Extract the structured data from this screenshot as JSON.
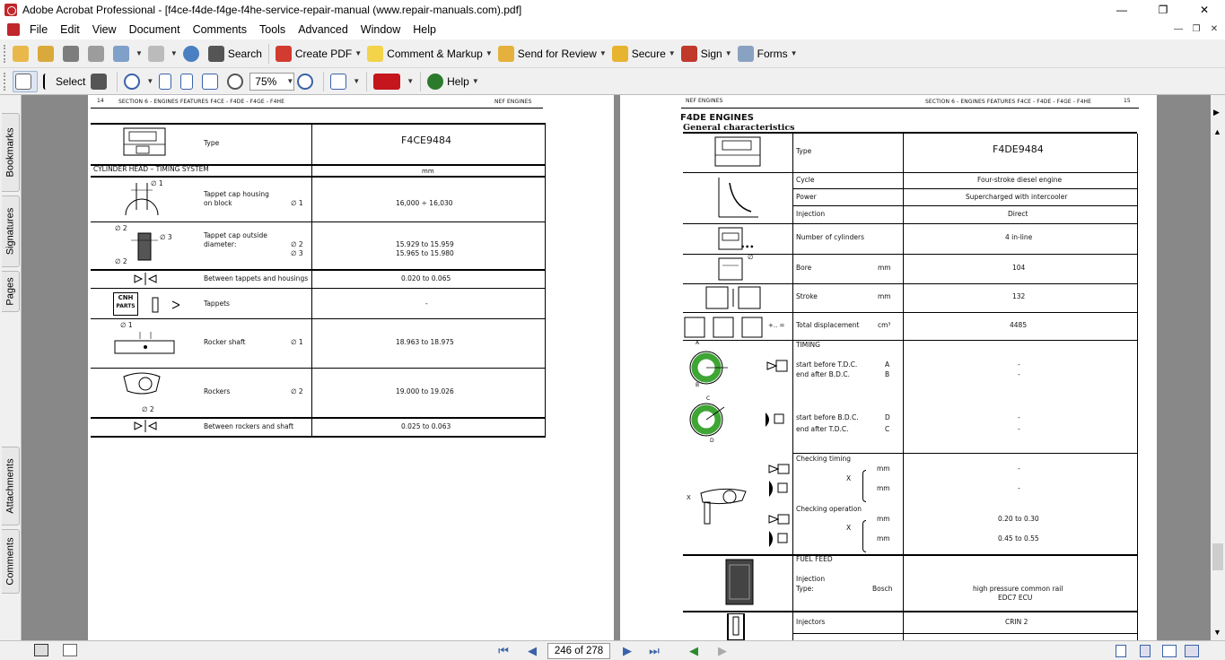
{
  "window": {
    "title": "Adobe Acrobat Professional - [f4ce-f4de-f4ge-f4he-service-repair-manual (www.repair-manuals.com).pdf]",
    "minimize": "—",
    "maximize": "❐",
    "close": "✕"
  },
  "menu": [
    "File",
    "Edit",
    "View",
    "Document",
    "Comments",
    "Tools",
    "Advanced",
    "Window",
    "Help"
  ],
  "toolbar1": {
    "search": "Search",
    "create_pdf": "Create PDF",
    "comment_markup": "Comment & Markup",
    "send_review": "Send for Review",
    "secure": "Secure",
    "sign": "Sign",
    "forms": "Forms"
  },
  "toolbar2": {
    "select": "Select",
    "zoom": "75%",
    "help": "Help"
  },
  "side_tabs": [
    "Bookmarks",
    "Signatures",
    "Pages",
    "Attachments",
    "Comments"
  ],
  "status": {
    "page_box": "246 of 278"
  },
  "left_page": {
    "header_num": "14",
    "header_center": "SECTION 6 - ENGINES FEATURES F4CE - F4DE - F4GE - F4HE",
    "header_right": "NEF ENGINES",
    "type_label": "Type",
    "type_value": "F4CE9484",
    "section": "CYLINDER HEAD – TIMING SYSTEM",
    "unit": "mm",
    "cnh_1": "CNH",
    "cnh_2": "PARTS",
    "rows": [
      {
        "label": "Tappet cap housing\non block",
        "sym": "∅ 1",
        "value": "16,000 ÷ 16,030",
        "pic1": "∅ 1"
      },
      {
        "label": "Tappet cap outside\ndiameter:",
        "sym": "∅ 2\n∅ 3",
        "value": "15.929 to 15.959\n15.965 to 15.980",
        "pic1": "∅ 2",
        "pic2": "∅ 3",
        "pic3": "∅ 2"
      },
      {
        "label": "Between tappets and housings",
        "sym": "",
        "value": "0.020 to 0.065"
      },
      {
        "label": "Tappets",
        "sym": "",
        "value": "-"
      },
      {
        "label": "Rocker shaft",
        "sym": "∅ 1",
        "value": "18.963 to 18.975",
        "pic1": "∅ 1"
      },
      {
        "label": "Rockers",
        "sym": "∅ 2",
        "value": "19.000 to 19.026",
        "pic1": "∅ 2"
      },
      {
        "label": "Between rockers and shaft",
        "sym": "",
        "value": "0.025 to 0.063"
      }
    ]
  },
  "right_page": {
    "header_left": "NEF ENGINES",
    "header_center": "SECTION 6 - ENGINES FEATURES F4CE - F4DE - F4GE - F4HE",
    "header_num": "15",
    "title1": "F4DE ENGINES",
    "title2": "General characteristics",
    "type_label": "Type",
    "type_value": "F4DE9484",
    "cycle_label": "Cycle",
    "cycle_value": "Four-stroke diesel engine",
    "power_label": "Power",
    "power_value": "Supercharged with intercooler",
    "injection_label": "Injection",
    "injection_value": "Direct",
    "cyl_label": "Number of cylinders",
    "cyl_value": "4 in-line",
    "bore_label": "Bore",
    "bore_unit": "mm",
    "bore_value": "104",
    "stroke_label": "Stroke",
    "stroke_unit": "mm",
    "stroke_value": "132",
    "disp_label": "Total displacement",
    "disp_unit": "cm³",
    "disp_value": "4485",
    "disp_sym": "+.. =",
    "timing_title": "TIMING",
    "t1_a": "start before T.D.C.",
    "t1_a_l": "A",
    "t1_b": "end after B.D.C.",
    "t1_b_l": "B",
    "t2_a": "start before B.D.C.",
    "t2_a_l": "D",
    "t2_b": "end after T.D.C.",
    "t2_b_l": "C",
    "dash": "-",
    "check_timing": "Checking timing",
    "check_op": "Checking operation",
    "x_mark": "X",
    "mm": "mm",
    "op_v1": "0.20 to 0.30",
    "op_v2": "0.45 to 0.55",
    "fuel_title": "FUEL FEED",
    "fuel_inj": "Injection",
    "fuel_type": "Type:",
    "fuel_brand": "Bosch",
    "fuel_v1": "high pressure common rail",
    "fuel_v2": "EDC7 ECU",
    "injectors_label": "Injectors",
    "injectors_value": "CRIN 2",
    "diag_a": "A",
    "diag_b": "B",
    "diag_c": "C",
    "diag_d": "D",
    "diag_x": "X",
    "pic_sym_o": "∅",
    "dots": "•••"
  }
}
